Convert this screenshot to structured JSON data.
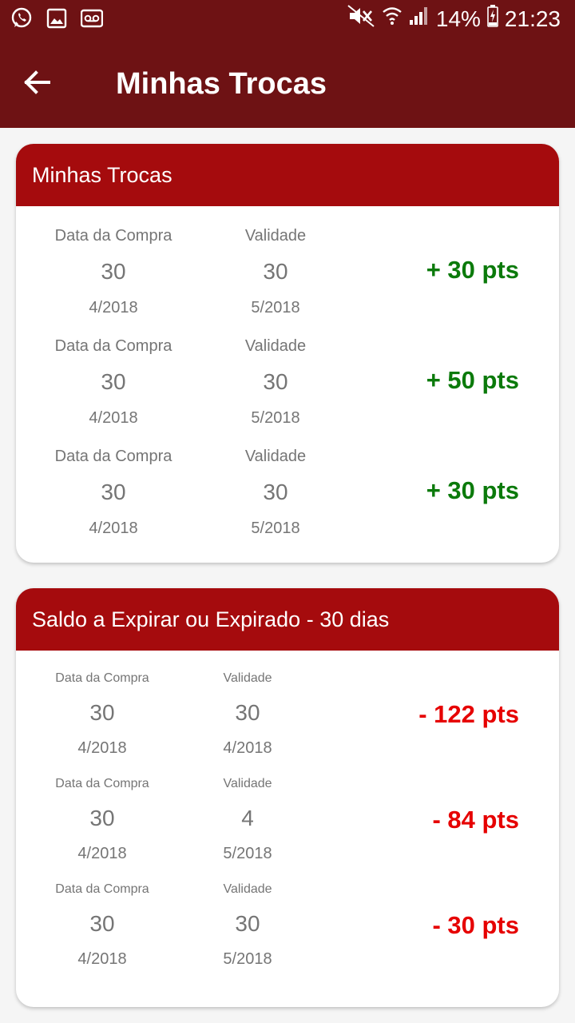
{
  "status_bar": {
    "battery": "14%",
    "time": "21:23"
  },
  "app_bar": {
    "title": "Minhas Trocas"
  },
  "colors": {
    "app_bar": "#6e1214",
    "card_header": "#a50b0d",
    "positive": "#0b7a0b",
    "negative": "#e60000"
  },
  "trocas": {
    "title": "Minhas Trocas",
    "rows": [
      {
        "purchase_label": "Data da Compra",
        "purchase_day": "30",
        "purchase_month": "4/2018",
        "validity_label": "Validade",
        "validity_day": "30",
        "validity_month": "5/2018",
        "points": "+ 30 pts"
      },
      {
        "purchase_label": "Data da Compra",
        "purchase_day": "30",
        "purchase_month": "4/2018",
        "validity_label": "Validade",
        "validity_day": "30",
        "validity_month": "5/2018",
        "points": "+ 50 pts"
      },
      {
        "purchase_label": "Data da Compra",
        "purchase_day": "30",
        "purchase_month": "4/2018",
        "validity_label": "Validade",
        "validity_day": "30",
        "validity_month": "5/2018",
        "points": "+ 30 pts"
      }
    ]
  },
  "expirar": {
    "title": "Saldo a Expirar ou Expirado - 30 dias",
    "rows": [
      {
        "purchase_label": "Data da Compra",
        "purchase_day": "30",
        "purchase_month": "4/2018",
        "validity_label": "Validade",
        "validity_day": "30",
        "validity_month": "4/2018",
        "points": "- 122 pts"
      },
      {
        "purchase_label": "Data da Compra",
        "purchase_day": "30",
        "purchase_month": "4/2018",
        "validity_label": "Validade",
        "validity_day": "4",
        "validity_month": "5/2018",
        "points": "- 84 pts"
      },
      {
        "purchase_label": "Data da Compra",
        "purchase_day": "30",
        "purchase_month": "4/2018",
        "validity_label": "Validade",
        "validity_day": "30",
        "validity_month": "5/2018",
        "points": "- 30 pts"
      }
    ]
  }
}
